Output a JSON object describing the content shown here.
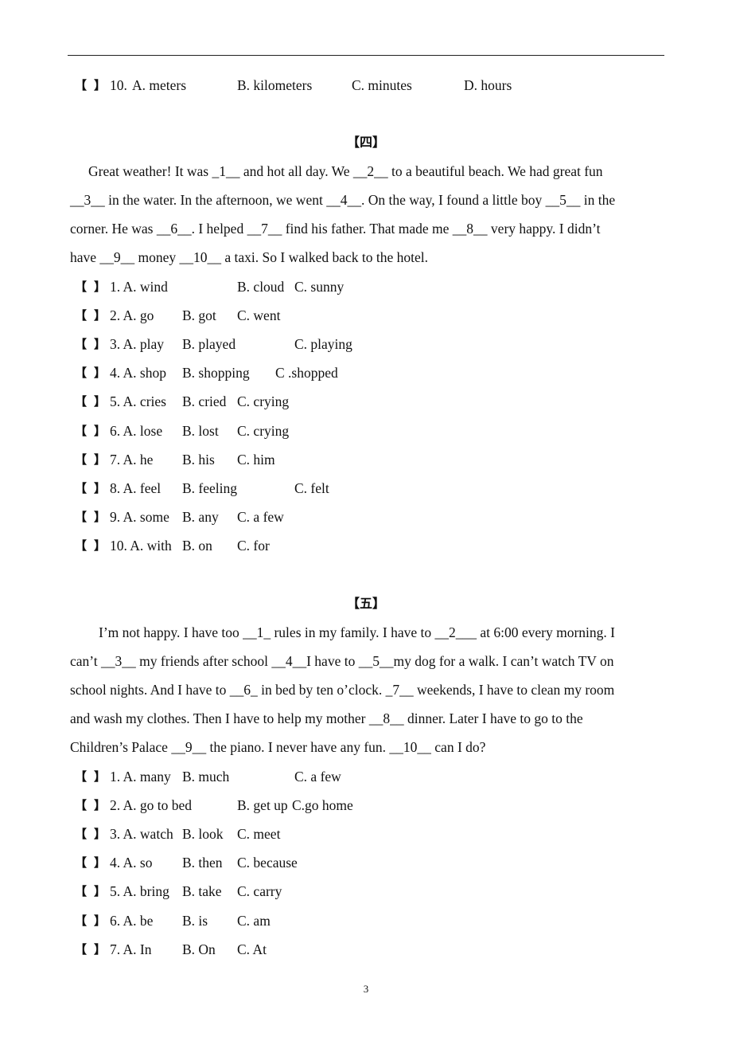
{
  "top_question": {
    "bracket_open": "【",
    "bracket_close": "】",
    "num": "10.",
    "a": "A. meters",
    "b": "B. kilometers",
    "c": "C. minutes",
    "d": "D. hours"
  },
  "section4": {
    "heading": "【四】",
    "passage": [
      "Great weather! It was _1__ and hot all day. We __2__ to a beautiful beach. We had great fun",
      "__3__ in the water. In the afternoon, we went __4__. On the way, I found a little boy __5__ in the",
      "corner. He was __6__. I helped __7__ find his father. That made me __8__ very happy. I didn’t",
      "have __9__ money __10__ a taxi. So I walked back to the hotel."
    ],
    "questions": [
      {
        "num": "1. A. wind",
        "b": "B. cloud",
        "c": "C. sunny"
      },
      {
        "num": "2. A. go",
        "b": "B. got",
        "c": "C. went"
      },
      {
        "num": "3. A. play",
        "b": "B. played",
        "c": "C. playing"
      },
      {
        "num": "4. A. shop",
        "b": "B. shopping",
        "c": "C .shopped"
      },
      {
        "num": "5. A. cries",
        "b": "B. cried",
        "c": "C. crying"
      },
      {
        "num": "6. A. lose",
        "b": "B. lost",
        "c": "C. crying"
      },
      {
        "num": "7. A. he",
        "b": "B. his",
        "c": "C. him"
      },
      {
        "num": "8. A. feel",
        "b": "B. feeling",
        "c": "C. felt"
      },
      {
        "num": "9. A. some",
        "b": "B. any",
        "c": "C. a few"
      },
      {
        "num": "10. A. with",
        "b": "B. on",
        "c": "C. for"
      }
    ]
  },
  "section5": {
    "heading": "【五】",
    "passage": [
      "I’m not happy. I have too __1_ rules in my family. I have to __2___ at 6:00 every morning. I",
      "can’t __3__ my friends after school __4__I have to __5__my dog for a walk. I can’t watch TV on",
      "school nights. And I have to __6_ in bed by ten o’clock. _7__ weekends, I have to clean my room",
      "and wash my clothes. Then I have to help my mother __8__ dinner. Later I have to go to the",
      "Children’s Palace __9__ the piano. I never have any fun. __10__ can I do?"
    ],
    "questions": [
      {
        "num": "1. A. many",
        "b": "B. much",
        "c": "C. a few"
      },
      {
        "num": "2. A. go to bed",
        "b": "B. get up",
        "c": "C.go home"
      },
      {
        "num": "3. A. watch",
        "b": "B. look",
        "c": "C. meet"
      },
      {
        "num": "4. A. so",
        "b": "B. then",
        "c": "C. because"
      },
      {
        "num": "5. A. bring",
        "b": "B. take",
        "c": "C. carry"
      },
      {
        "num": "6. A. be",
        "b": "B. is",
        "c": "C. am"
      },
      {
        "num": "7. A. In",
        "b": "B. On",
        "c": "C. At"
      }
    ]
  },
  "brackets": {
    "open": "【",
    "close": "】"
  },
  "page_number": "3"
}
